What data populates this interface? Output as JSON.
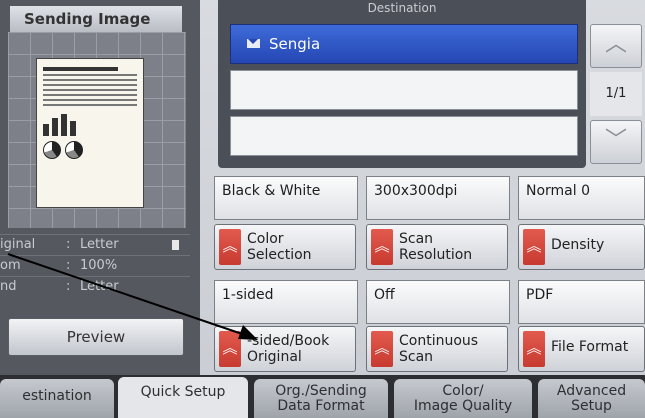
{
  "left_panel": {
    "title": "Sending Image",
    "info": [
      {
        "key": "iginal",
        "value": "Letter"
      },
      {
        "key": "om",
        "value": "100%"
      },
      {
        "key": "nd",
        "value": "Letter"
      }
    ],
    "preview_label": "Preview"
  },
  "destination": {
    "header": "Destination",
    "entry": "Sengia",
    "page_indicator": "1/1"
  },
  "settings": {
    "color_value": "Black & White",
    "color_button": [
      "Color",
      "Selection"
    ],
    "resolution_value": "300x300dpi",
    "resolution_button": [
      "Scan",
      "Resolution"
    ],
    "density_value": "Normal 0",
    "density_button": "Density",
    "sided_value": "1-sided",
    "sided_button": [
      "-sided/Book",
      "Original"
    ],
    "continuous_value": "Off",
    "continuous_button": [
      "Continuous",
      "Scan"
    ],
    "format_value": "PDF",
    "format_button": "File Format"
  },
  "tabs": [
    {
      "label": "estination"
    },
    {
      "label": "Quick Setup"
    },
    {
      "label_l1": "Org./Sending",
      "label_l2": "Data Format"
    },
    {
      "label_l1": "Color/",
      "label_l2": "Image Quality"
    },
    {
      "label_l1": "Advanced",
      "label_l2": "Setup"
    }
  ],
  "icons": {
    "destination_entry": "mail-icon",
    "scroll_up": "chevron-up-icon",
    "scroll_down": "chevron-down-icon",
    "setting_button_tab": "double-chevron-up-icon",
    "page_indicator": "page-icon"
  },
  "colors": {
    "selected_destination": "#2f58c4",
    "button_tab_red": "#d64a3f",
    "panel_dark": "#55585e"
  }
}
